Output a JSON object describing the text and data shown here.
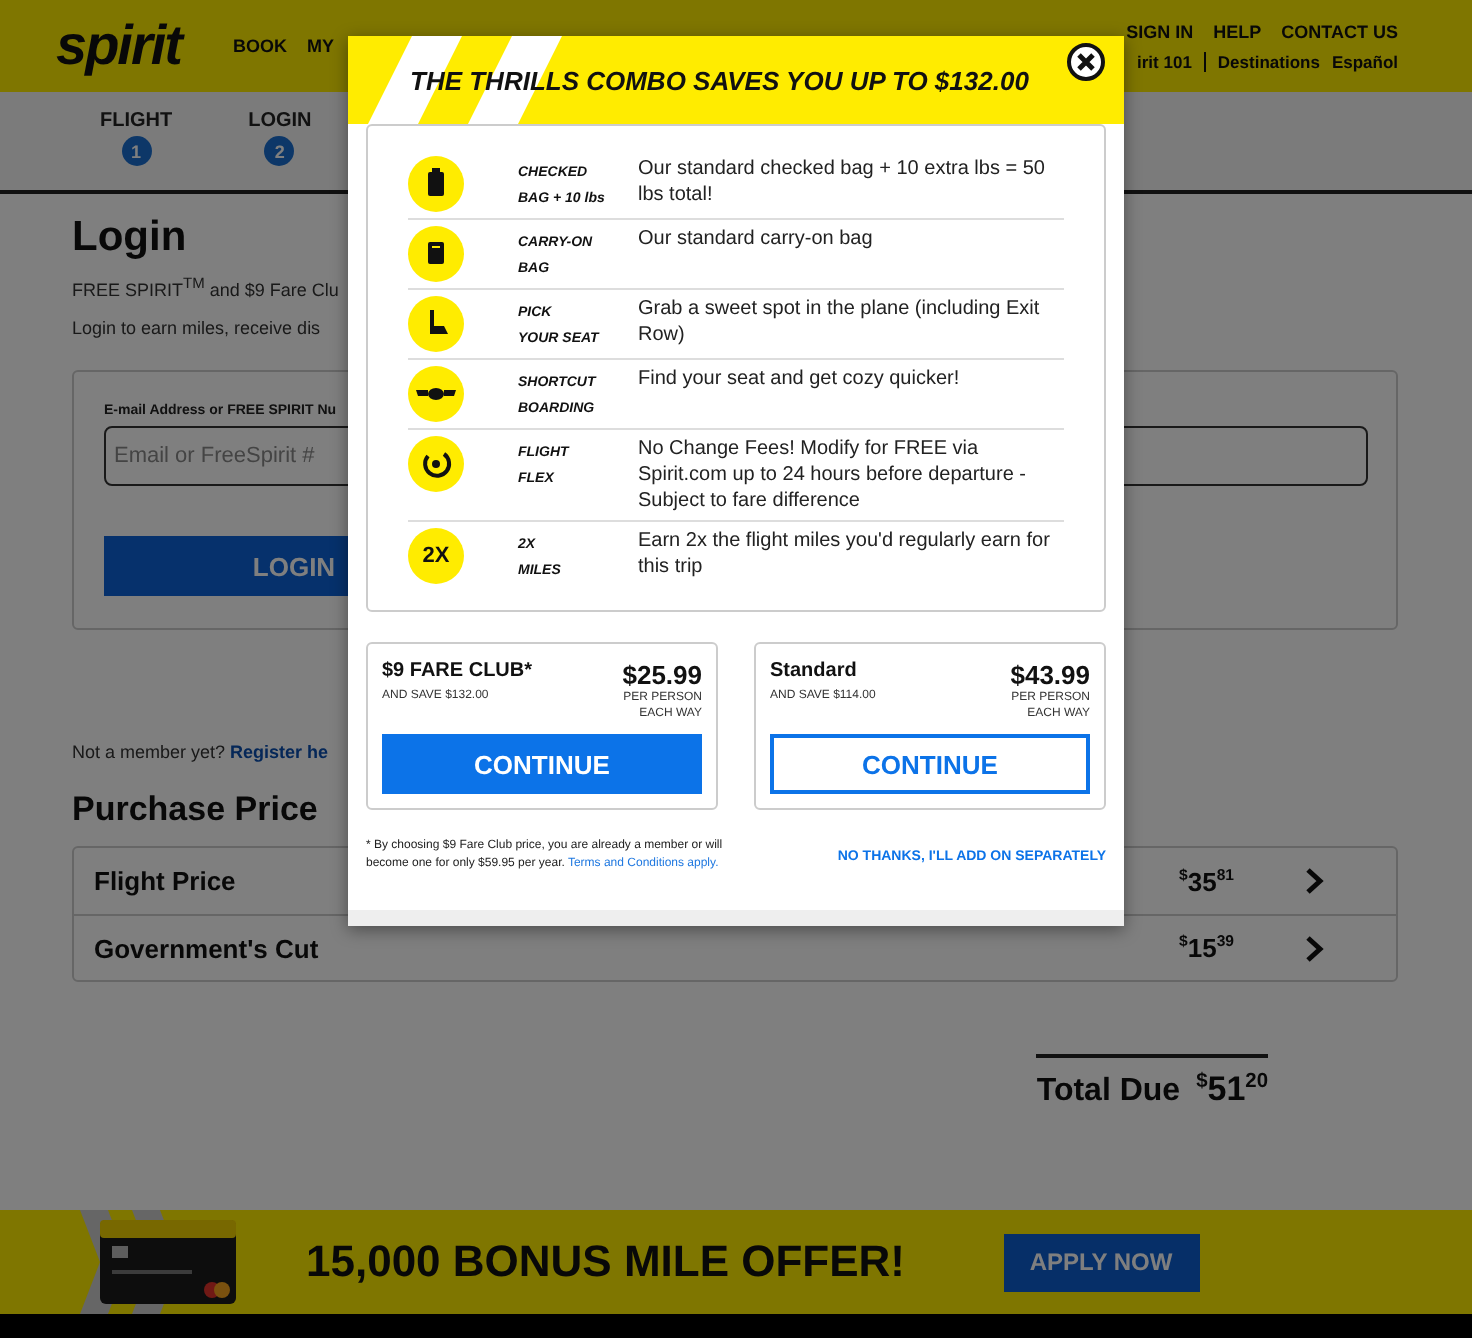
{
  "header": {
    "logo": "spirit",
    "nav": [
      "BOOK",
      "MY"
    ],
    "utility_links": [
      "SIGN IN",
      "HELP",
      "CONTACT US"
    ],
    "secondary_links": [
      "irit 101",
      "Destinations",
      "Español"
    ]
  },
  "steps": [
    {
      "label": "FLIGHT",
      "number": "1"
    },
    {
      "label": "LOGIN",
      "number": "2"
    }
  ],
  "login": {
    "title": "Login",
    "intro": "FREE SPIRIT$^{TM}$ and $9 Fare Clu",
    "subtext": "Login to earn miles, receive dis",
    "field_label": "E-mail Address or FREE SPIRIT Nu",
    "placeholder": "Email or FreeSpirit #",
    "button": "LOGIN"
  },
  "register": {
    "text": "Not a member yet?",
    "link": "Register he"
  },
  "purchase": {
    "title": "Purchase Price",
    "rows": [
      {
        "label": "Flight Price",
        "symbol": "$",
        "dollars": "35",
        "cents": "81"
      },
      {
        "label": "Government's Cut",
        "symbol": "$",
        "dollars": "15",
        "cents": "39"
      }
    ],
    "total": {
      "label": "Total Due",
      "symbol": "$",
      "dollars": "51",
      "cents": "20"
    }
  },
  "modal": {
    "title": "THE THRILLS COMBO SAVES YOU UP TO $132.00",
    "benefits": [
      {
        "label_lines": [
          "CHECKED",
          "BAG + 10 lbs"
        ],
        "description": "Our standard checked bag + 10 extra lbs = 50 lbs total!"
      },
      {
        "label_lines": [
          "CARRY-ON",
          "BAG"
        ],
        "description": "Our standard carry-on bag"
      },
      {
        "label_lines": [
          "PICK",
          "YOUR SEAT"
        ],
        "description": "Grab a sweet spot in the plane (including Exit Row)"
      },
      {
        "label_lines": [
          "SHORTCUT",
          "BOARDING"
        ],
        "description": "Find your seat and get cozy quicker!"
      },
      {
        "label_lines": [
          "FLIGHT",
          "FLEX"
        ],
        "description": "No Change Fees! Modify for FREE via Spirit.com up to 24 hours before departure - Subject to fare difference"
      },
      {
        "label_lines": [
          "2X",
          "MILES"
        ],
        "description": "Earn 2x the flight miles you'd regularly earn for this trip",
        "badge": "2X"
      }
    ],
    "plans": [
      {
        "name": "$9 FARE CLUB*",
        "savings": "AND SAVE $132.00",
        "price": "$25.99",
        "per_lines": [
          "PER PERSON",
          "EACH WAY"
        ],
        "button": "CONTINUE",
        "selected": true
      },
      {
        "name": "Standard",
        "savings": "AND SAVE $114.00",
        "price": "$43.99",
        "per_lines": [
          "PER PERSON",
          "EACH WAY"
        ],
        "button": "CONTINUE",
        "selected": false
      }
    ],
    "footnote": "* By choosing $9 Fare Club price, you are already a member or will become one for only $59.95 per year.",
    "footnote_link": "Terms and Conditions apply.",
    "decline": "NO THANKS, I'LL ADD ON SEPARATELY"
  },
  "banner": {
    "headline": "15,000 BONUS MILE OFFER!",
    "button": "APPLY NOW"
  }
}
